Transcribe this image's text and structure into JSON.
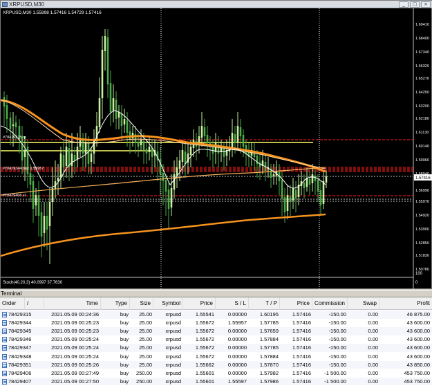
{
  "chart": {
    "window_title": "XRPUSD,M30",
    "ohlc_label": "XRPUSD,M30  1.55898 1.57416 1.54729 1.57416",
    "indicator_label": "Stoch(40,20,3) 40.0997 37.7630",
    "price_axis": [
      "1.69410",
      "1.67340",
      "1.65270",
      "1.63200",
      "1.61130",
      "1.59060",
      "1.56990",
      "1.54920",
      "1.52850",
      "1.50780",
      "1.48850"
    ],
    "price_axis_mid": [
      "1.68400",
      "1.66320",
      "1.64250",
      "1.62180",
      "1.60140",
      "1.58040",
      "1.55970",
      "1.53900",
      "1.51830"
    ],
    "current_price": "1.57416",
    "stoch_axis": [
      "0",
      "100"
    ],
    "line_labels": [
      "#78429315 tp",
      "#78429344 buy 1.55957",
      "#78429406 sl"
    ],
    "colors": {
      "background": "#000000",
      "bull": "#c8f0a0",
      "bear": "#4caa48",
      "ma_orange": "#f7931e",
      "ma_white": "#ffffff",
      "line_yellow": "#ffff66",
      "level_red": "#ff2020",
      "current_price_bg": "#ffffff"
    }
  },
  "chart_data": {
    "type": "candlestick",
    "title": "XRPUSD,M30",
    "ylim": [
      1.4885,
      1.6941
    ],
    "ohlc": [
      1.55898,
      1.57416,
      1.54729,
      1.57416
    ]
  },
  "terminal": {
    "title": "Terminal",
    "columns": [
      "Order",
      "/",
      "Time",
      "Type",
      "Size",
      "Symbol",
      "Price",
      "S / L",
      "T / P",
      "Price",
      "Commission",
      "Swap",
      "Profit"
    ],
    "rows": [
      [
        "78429315",
        "2021.05.09 00:24:36",
        "buy",
        "25.00",
        "xrpusd",
        "1.55541",
        "0.00000",
        "1.60195",
        "1.57416",
        "-150.00",
        "0.00",
        "46 875.00"
      ],
      [
        "78429344",
        "2021.05.09 00:25:23",
        "buy",
        "25.00",
        "xrpusd",
        "1.55672",
        "1.55957",
        "1.57785",
        "1.57416",
        "-150.00",
        "0.00",
        "43 600.00"
      ],
      [
        "78429345",
        "2021.05.09 00:25:23",
        "buy",
        "25.00",
        "xrpusd",
        "1.55672",
        "0.00000",
        "1.57659",
        "1.57416",
        "-150.00",
        "0.00",
        "43 600.00"
      ],
      [
        "78429346",
        "2021.05.09 00:25:24",
        "buy",
        "25.00",
        "xrpusd",
        "1.55672",
        "0.00000",
        "1.57884",
        "1.57416",
        "-150.00",
        "0.00",
        "43 600.00"
      ],
      [
        "78429347",
        "2021.05.09 00:25:24",
        "buy",
        "25.00",
        "xrpusd",
        "1.55672",
        "0.00000",
        "1.57785",
        "1.57416",
        "-150.00",
        "0.00",
        "43 600.00"
      ],
      [
        "78429348",
        "2021.05.09 00:25:24",
        "buy",
        "25.00",
        "xrpusd",
        "1.55672",
        "0.00000",
        "1.57884",
        "1.57416",
        "-150.00",
        "0.00",
        "43 600.00"
      ],
      [
        "78429351",
        "2021.05.09 00:25:26",
        "buy",
        "25.00",
        "xrpusd",
        "1.55662",
        "0.00000",
        "1.57870",
        "1.57416",
        "-150.00",
        "0.00",
        "43 850.00"
      ],
      [
        "78429406",
        "2021.05.09 00:27:49",
        "buy",
        "250.00",
        "xrpusd",
        "1.55601",
        "0.00000",
        "1.57982",
        "1.57416",
        "-1 500.00",
        "0.00",
        "453 750.00"
      ],
      [
        "78429407",
        "2021.05.09 00:27:50",
        "buy",
        "250.00",
        "xrpusd",
        "1.55601",
        "1.55597",
        "1.57986",
        "1.57416",
        "-1 500.00",
        "0.00",
        "453 750.00"
      ]
    ]
  }
}
